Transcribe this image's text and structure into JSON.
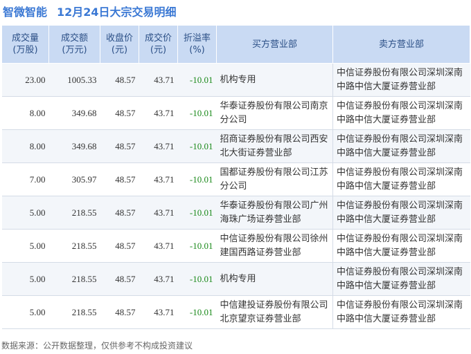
{
  "header": {
    "stock_name": "智微智能",
    "title": "12月24日大宗交易明细"
  },
  "table": {
    "columns": [
      {
        "line1": "成交量",
        "line2": "(万股)"
      },
      {
        "line1": "成交额",
        "line2": "(万元)"
      },
      {
        "line1": "收盘价",
        "line2": "(元)"
      },
      {
        "line1": "成交价",
        "line2": "(元)"
      },
      {
        "line1": "折溢率",
        "line2": "(%)"
      },
      {
        "line1": "买方营业部",
        "line2": ""
      },
      {
        "line1": "卖方营业部",
        "line2": ""
      }
    ],
    "rows": [
      {
        "volume": "23.00",
        "amount": "1005.33",
        "close": "48.57",
        "price": "43.71",
        "premium": "-10.01",
        "buyer": "机构专用",
        "seller": "中信证券股份有限公司深圳深南中路中信大厦证券营业部"
      },
      {
        "volume": "8.00",
        "amount": "349.68",
        "close": "48.57",
        "price": "43.71",
        "premium": "-10.01",
        "buyer": "华泰证券股份有限公司南京分公司",
        "seller": "中信证券股份有限公司深圳深南中路中信大厦证券营业部"
      },
      {
        "volume": "8.00",
        "amount": "349.68",
        "close": "48.57",
        "price": "43.71",
        "premium": "-10.01",
        "buyer": "招商证券股份有限公司西安北大街证券营业部",
        "seller": "中信证券股份有限公司深圳深南中路中信大厦证券营业部"
      },
      {
        "volume": "7.00",
        "amount": "305.97",
        "close": "48.57",
        "price": "43.71",
        "premium": "-10.01",
        "buyer": "国都证券股份有限公司江苏分公司",
        "seller": "中信证券股份有限公司深圳深南中路中信大厦证券营业部"
      },
      {
        "volume": "5.00",
        "amount": "218.55",
        "close": "48.57",
        "price": "43.71",
        "premium": "-10.01",
        "buyer": "华泰证券股份有限公司广州海珠广场证券营业部",
        "seller": "中信证券股份有限公司深圳深南中路中信大厦证券营业部"
      },
      {
        "volume": "5.00",
        "amount": "218.55",
        "close": "48.57",
        "price": "43.71",
        "premium": "-10.01",
        "buyer": "中信证券股份有限公司徐州建国西路证券营业部",
        "seller": "中信证券股份有限公司深圳深南中路中信大厦证券营业部"
      },
      {
        "volume": "5.00",
        "amount": "218.55",
        "close": "48.57",
        "price": "43.71",
        "premium": "-10.01",
        "buyer": "机构专用",
        "seller": "中信证券股份有限公司深圳深南中路中信大厦证券营业部"
      },
      {
        "volume": "5.00",
        "amount": "218.55",
        "close": "48.57",
        "price": "43.71",
        "premium": "-10.01",
        "buyer": "中信建投证券股份有限公司北京望京证券营业部",
        "seller": "中信证券股份有限公司深圳深南中路中信大厦证券营业部"
      }
    ]
  },
  "footer": {
    "source": "数据来源：公开数据整理，仅供参考不构成投资建议"
  },
  "watermark": {
    "text": "证券之星"
  },
  "colors": {
    "title": "#3a78d4",
    "header_bg": "#c9daf3",
    "header_text": "#2b4f86",
    "negative": "#1b8a1b",
    "row_alt": "#f3f6fa"
  }
}
